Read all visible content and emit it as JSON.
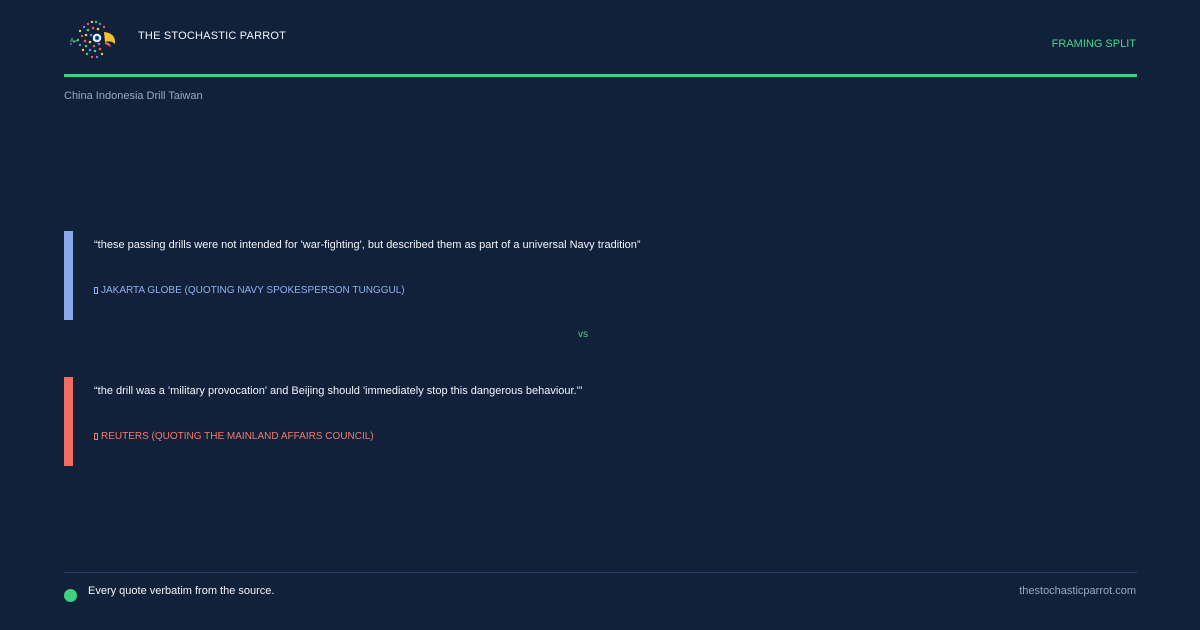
{
  "header": {
    "brand": "THE STOCHASTIC PARROT",
    "tag": "FRAMING SPLIT",
    "topic": "China Indonesia Drill Taiwan"
  },
  "colors": {
    "background": "#12213a",
    "accent": "#3fd17f",
    "quote1_accent": "#8aa8ec",
    "quote2_accent": "#ee6f61"
  },
  "quotes": [
    {
      "text": "“these passing drills were not intended for 'war-fighting', but described them as part of a universal Navy tradition”",
      "source": "JAKARTA GLOBE (QUOTING NAVY SPOKESPERSON TUNGGUL)",
      "source_icon": "source-glyph-icon"
    },
    {
      "text": "“the drill was a 'military provocation' and Beijing should 'immediately stop this dangerous behaviour.'”",
      "source": "REUTERS (QUOTING THE MAINLAND AFFAIRS COUNCIL)",
      "source_icon": "source-glyph-icon"
    }
  ],
  "separator": "vs",
  "footer": {
    "note": "Every quote verbatim from the source.",
    "site": "thestochasticparrot.com"
  }
}
